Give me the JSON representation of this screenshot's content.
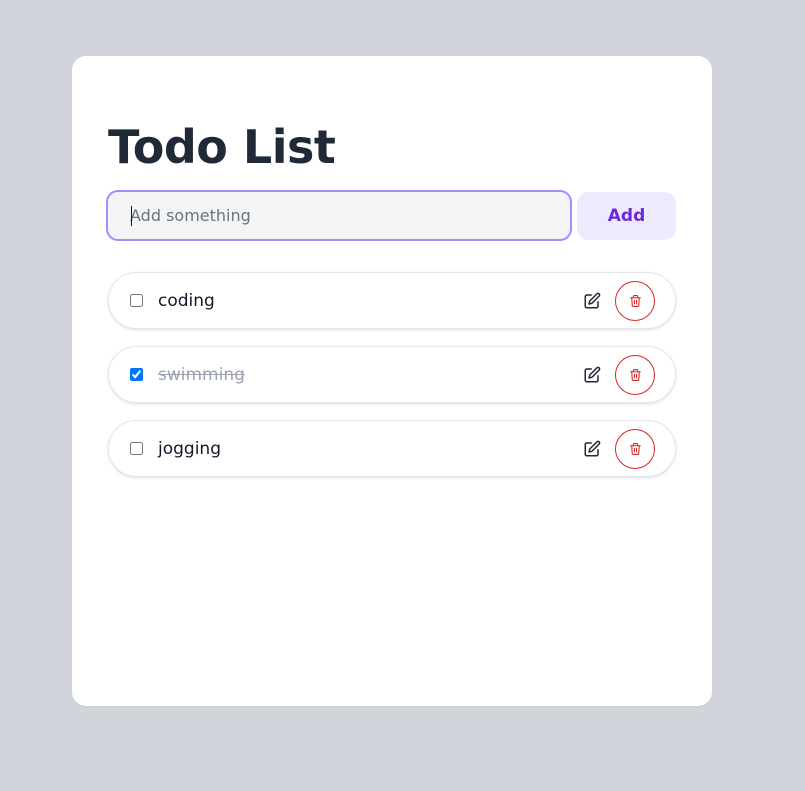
{
  "page": {
    "title": "Todo List"
  },
  "add_form": {
    "placeholder": "Add something",
    "value": "",
    "button_label": "Add"
  },
  "todos": [
    {
      "text": "coding",
      "done": false
    },
    {
      "text": "swimming",
      "done": true
    },
    {
      "text": "jogging",
      "done": false
    }
  ],
  "icons": {
    "edit": "pencil-square-icon",
    "delete": "trash-icon"
  },
  "colors": {
    "background": "#d1d5db",
    "card": "#ffffff",
    "title": "#1f2937",
    "input_border": "#a78bfa",
    "input_bg": "#f3f4f6",
    "add_button_bg": "#ede9fe",
    "add_button_text": "#6d28d9",
    "delete_accent": "#dc2626",
    "checkbox_accent": "#0075ff",
    "done_text": "#9ca3af"
  }
}
